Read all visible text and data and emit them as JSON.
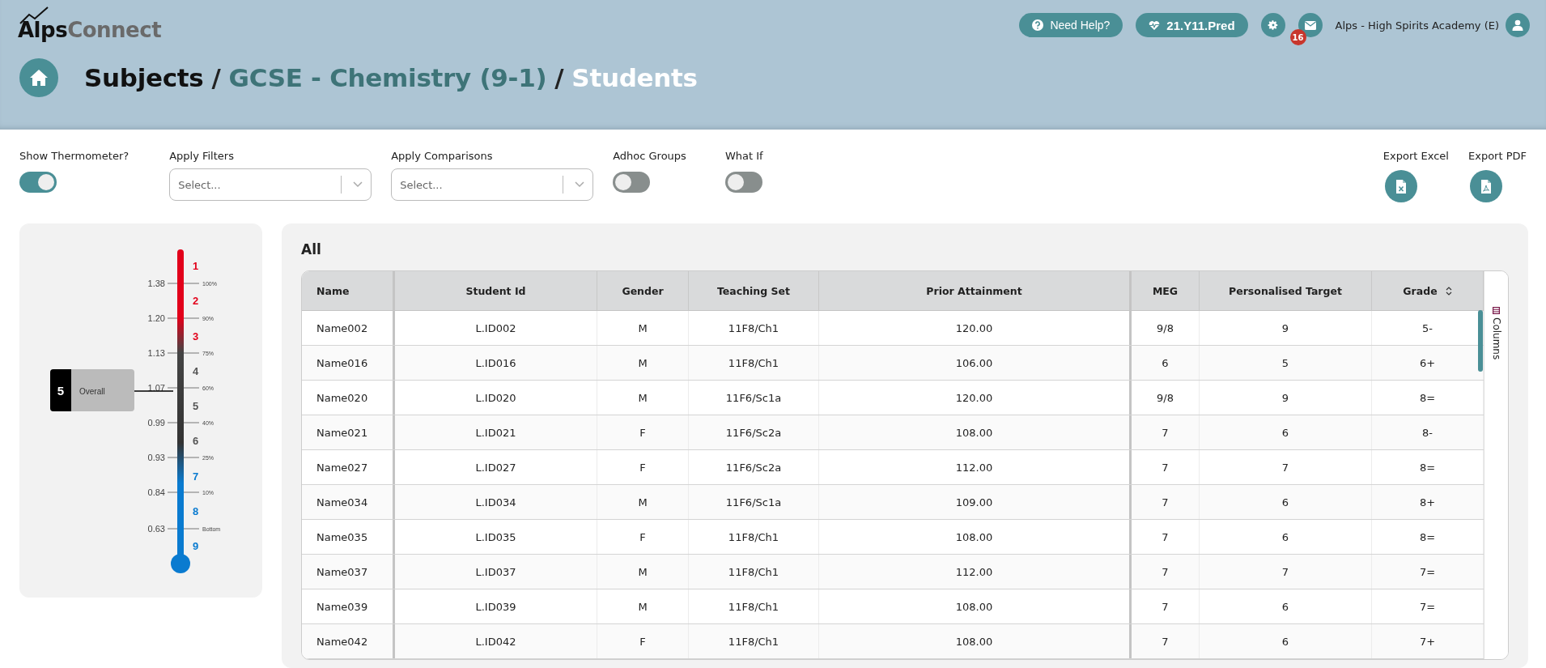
{
  "header": {
    "logo": {
      "part_1": "Alps",
      "part_2": "Connect"
    },
    "help_button": "Need Help?",
    "dataset_button": "21.Y11.Pred",
    "messages_badge": "16",
    "school_name": "Alps - High Spirits Academy (E)"
  },
  "breadcrumb": {
    "separator": "/",
    "items": [
      {
        "label": "Subjects",
        "kind": "root"
      },
      {
        "label": "GCSE - Chemistry (9-1)",
        "kind": "parent"
      },
      {
        "label": "Students",
        "kind": "current"
      }
    ]
  },
  "toolbar": {
    "controls": [
      {
        "kind": "toggle",
        "label": "Show Thermometer?",
        "on": true
      },
      {
        "kind": "select",
        "label": "Apply Filters",
        "placeholder": "Select..."
      },
      {
        "kind": "select",
        "label": "Apply Comparisons",
        "placeholder": "Select..."
      },
      {
        "kind": "toggle",
        "label": "Adhoc Groups",
        "on": false
      },
      {
        "kind": "toggle",
        "label": "What If",
        "on": false
      }
    ],
    "exports": [
      {
        "label": "Export Excel",
        "kind": "excel"
      },
      {
        "label": "Export PDF",
        "kind": "pdf"
      }
    ]
  },
  "thermometer": {
    "scale": [
      {
        "value": "1.38",
        "percent": "100%"
      },
      {
        "value": "1.20",
        "percent": "90%"
      },
      {
        "value": "1.13",
        "percent": "75%"
      },
      {
        "value": "1.07",
        "percent": "60%"
      },
      {
        "value": "0.99",
        "percent": "40%"
      },
      {
        "value": "0.93",
        "percent": "25%"
      },
      {
        "value": "0.84",
        "percent": "10%"
      },
      {
        "value": "0.63",
        "percent": "Bottom"
      }
    ],
    "grades": [
      {
        "label": "1",
        "color": "#e2001a"
      },
      {
        "label": "2",
        "color": "#e2001a"
      },
      {
        "label": "3",
        "color": "#e2001a"
      },
      {
        "label": "4",
        "color": "#555555"
      },
      {
        "label": "5",
        "color": "#555555"
      },
      {
        "label": "6",
        "color": "#555555"
      },
      {
        "label": "7",
        "color": "#0a7bd0"
      },
      {
        "label": "8",
        "color": "#0a7bd0"
      },
      {
        "label": "9",
        "color": "#0a7bd0"
      }
    ],
    "marker": {
      "grade": "5",
      "label": "Overall"
    }
  },
  "table": {
    "title": "All",
    "side_tab": "Columns",
    "columns": [
      {
        "label": "Name",
        "sortable": false
      },
      {
        "label": "Student Id",
        "sortable": false
      },
      {
        "label": "Gender",
        "sortable": false
      },
      {
        "label": "Teaching Set",
        "sortable": false
      },
      {
        "label": "Prior Attainment",
        "sortable": false
      },
      {
        "label": "MEG",
        "sortable": false
      },
      {
        "label": "Personalised Target",
        "sortable": false
      },
      {
        "label": "Grade",
        "sortable": true
      }
    ],
    "rows": [
      [
        "Name002",
        "L.ID002",
        "M",
        "11F8/Ch1",
        "120.00",
        "9/8",
        "9",
        "5-"
      ],
      [
        "Name016",
        "L.ID016",
        "M",
        "11F8/Ch1",
        "106.00",
        "6",
        "5",
        "6+"
      ],
      [
        "Name020",
        "L.ID020",
        "M",
        "11F6/Sc1a",
        "120.00",
        "9/8",
        "9",
        "8="
      ],
      [
        "Name021",
        "L.ID021",
        "F",
        "11F6/Sc2a",
        "108.00",
        "7",
        "6",
        "8-"
      ],
      [
        "Name027",
        "L.ID027",
        "F",
        "11F6/Sc2a",
        "112.00",
        "7",
        "7",
        "8="
      ],
      [
        "Name034",
        "L.ID034",
        "M",
        "11F6/Sc1a",
        "109.00",
        "7",
        "6",
        "8+"
      ],
      [
        "Name035",
        "L.ID035",
        "F",
        "11F8/Ch1",
        "108.00",
        "7",
        "6",
        "8="
      ],
      [
        "Name037",
        "L.ID037",
        "M",
        "11F8/Ch1",
        "112.00",
        "7",
        "7",
        "7="
      ],
      [
        "Name039",
        "L.ID039",
        "M",
        "11F8/Ch1",
        "108.00",
        "7",
        "6",
        "7="
      ],
      [
        "Name042",
        "L.ID042",
        "F",
        "11F8/Ch1",
        "108.00",
        "7",
        "6",
        "7+"
      ]
    ]
  }
}
